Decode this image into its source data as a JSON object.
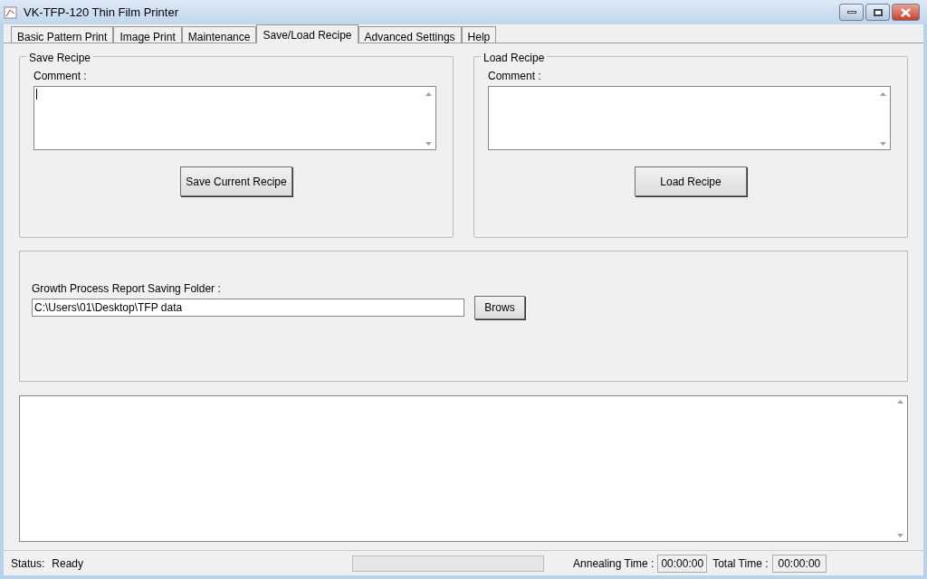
{
  "window": {
    "title": "VK-TFP-120 Thin Film Printer"
  },
  "tabs": [
    {
      "label": "Basic Pattern Print",
      "selected": false
    },
    {
      "label": "Image Print",
      "selected": false
    },
    {
      "label": "Maintenance",
      "selected": false
    },
    {
      "label": "Save/Load Recipe",
      "selected": true
    },
    {
      "label": "Advanced Settings",
      "selected": false
    },
    {
      "label": "Help",
      "selected": false
    }
  ],
  "recipe_groups": [
    {
      "title": "Save Recipe",
      "comment_label": "Comment :",
      "button": "Save Current Recipe",
      "focused": true
    },
    {
      "title": "Load Recipe",
      "comment_label": "Comment :",
      "button": "Load Recipe",
      "focused": false
    }
  ],
  "report_folder": {
    "label": "Growth Process Report Saving Folder :",
    "value": "C:\\Users\\01\\Desktop\\TFP data",
    "button": "Brows"
  },
  "status_bar": {
    "status_label": "Status:",
    "status": "Ready",
    "progress": {
      "level": 0
    },
    "annealing_label": "Annealing Time :",
    "annealing_time": "00:00:00",
    "total_label": "Total Time :",
    "total_time": "00:00:00"
  }
}
